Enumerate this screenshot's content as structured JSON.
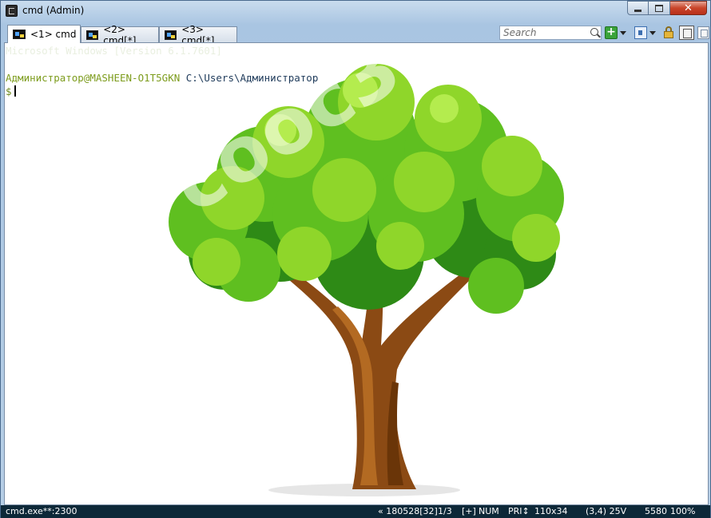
{
  "window": {
    "title": "cmd (Admin)",
    "min_label": "minimize",
    "max_label": "maximize",
    "close_glyph": "✕"
  },
  "tabs": [
    {
      "label": "<1> cmd",
      "icon": "console-tab-icon"
    },
    {
      "label": "<2> cmd[*]",
      "icon": "console-tab-icon"
    },
    {
      "label": "<3> cmd[*]",
      "icon": "console-tab-icon"
    }
  ],
  "toolbar": {
    "search_placeholder": "Search",
    "new_console_glyph": "+"
  },
  "console": {
    "version_line": "Microsoft Windows [Version 6.1.7601]",
    "prompt_user": "Администратор@MASHEEN-O1T5GKN",
    "prompt_path": "C:\\Users\\Администратор",
    "prompt_symbol": "$",
    "watermark": "cooc3.lnl"
  },
  "status": {
    "process": "cmd.exe**:2300",
    "buffer": "« 180528[32]",
    "pages": "1/3",
    "insert": "[+]",
    "numlock": "NUM",
    "priority": "PRI↕",
    "size": "110x34",
    "cursor": "(3,4) 25V",
    "pid": "5580",
    "zoom": "100%"
  },
  "colors": {
    "status_bg": "#0d2838",
    "prompt_user": "#7d9c1d",
    "prompt_path": "#1e3a5a",
    "leaf_light": "#8fd62a",
    "leaf_dark": "#3a9a1c",
    "trunk": "#8b4a14"
  }
}
